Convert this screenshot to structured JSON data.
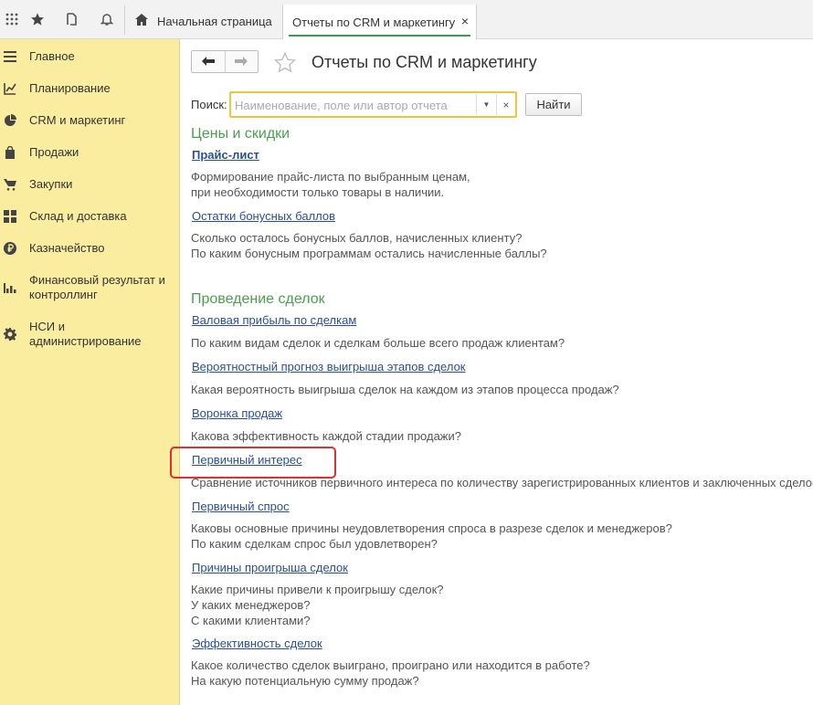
{
  "topbar": {
    "icons": [
      "apps-grid-icon",
      "favorites-star-icon",
      "history-icon",
      "notifications-bell-icon"
    ],
    "tabs": [
      {
        "label": "Начальная страница",
        "icon": "home-icon"
      },
      {
        "label": "Отчеты по CRM и маркетингу",
        "close": "×"
      }
    ]
  },
  "sidebar": {
    "items": [
      {
        "label": "Главное",
        "icon": "menu-lines-icon"
      },
      {
        "label": "Планирование",
        "icon": "planning-chart-icon"
      },
      {
        "label": "CRM и маркетинг",
        "icon": "pie-chart-icon"
      },
      {
        "label": "Продажи",
        "icon": "shopping-bag-icon"
      },
      {
        "label": "Закупки",
        "icon": "cart-icon"
      },
      {
        "label": "Склад и доставка",
        "icon": "warehouse-grid-icon"
      },
      {
        "label": "Казначейство",
        "icon": "ruble-coin-icon"
      },
      {
        "label": "Финансовый результат и контроллинг",
        "icon": "bar-chart-icon"
      },
      {
        "label": "НСИ и администрирование",
        "icon": "gear-icon"
      }
    ]
  },
  "page": {
    "title": "Отчеты по CRM и маркетингу",
    "search_label": "Поиск:",
    "search_placeholder": "Наименование, поле или автор отчета",
    "search_value": "",
    "find_button": "Найти"
  },
  "sections": [
    {
      "title": "Цены и скидки",
      "reports": [
        {
          "link": "Прайс-лист",
          "desc": [
            "Формирование прайс-листа по выбранным ценам,",
            "при необходимости только товары в наличии."
          ]
        },
        {
          "link": "Остатки бонусных баллов",
          "desc": [
            "Сколько осталось бонусных баллов, начисленных клиенту?",
            "По каким бонусным программам остались начисленные баллы?"
          ]
        }
      ]
    },
    {
      "title": "Проведение сделок",
      "reports": [
        {
          "link": "Валовая прибыль по сделкам",
          "desc": [
            "По каким видам сделок и сделкам больше всего продаж клиентам?"
          ]
        },
        {
          "link": "Вероятностный прогноз выигрыша этапов сделок",
          "desc": [
            "Какая вероятность выигрыша сделок на каждом из этапов процесса продаж?"
          ]
        },
        {
          "link": "Воронка продаж",
          "desc": [
            "Какова эффективность каждой стадии продажи?"
          ]
        },
        {
          "link": "Первичный интерес",
          "desc": [
            "Сравнение источников первичного интереса по количеству зарегистрированных клиентов и заключенных сделок"
          ]
        },
        {
          "link": "Первичный спрос",
          "desc": [
            "Каковы основные причины неудовлетворения спроса в разрезе сделок и менеджеров?",
            "По каким сделкам спрос был удовлетворен?"
          ]
        },
        {
          "link": "Причины проигрыша сделок",
          "desc": [
            "Какие причины привели к проигрышу сделок?",
            "У каких менеджеров?",
            "С какими клиентами?"
          ]
        },
        {
          "link": "Эффективность сделок",
          "desc": [
            "Какое количество сделок выиграно, проиграно или находится в работе?",
            "На какую потенциальную сумму продаж?"
          ]
        }
      ]
    }
  ],
  "colors": {
    "sidebar_bg": "#fbeda0",
    "section_title": "#4c9f4f",
    "link": "#2a4f96",
    "highlight": "#e03131",
    "search_border": "#f0c43c"
  }
}
